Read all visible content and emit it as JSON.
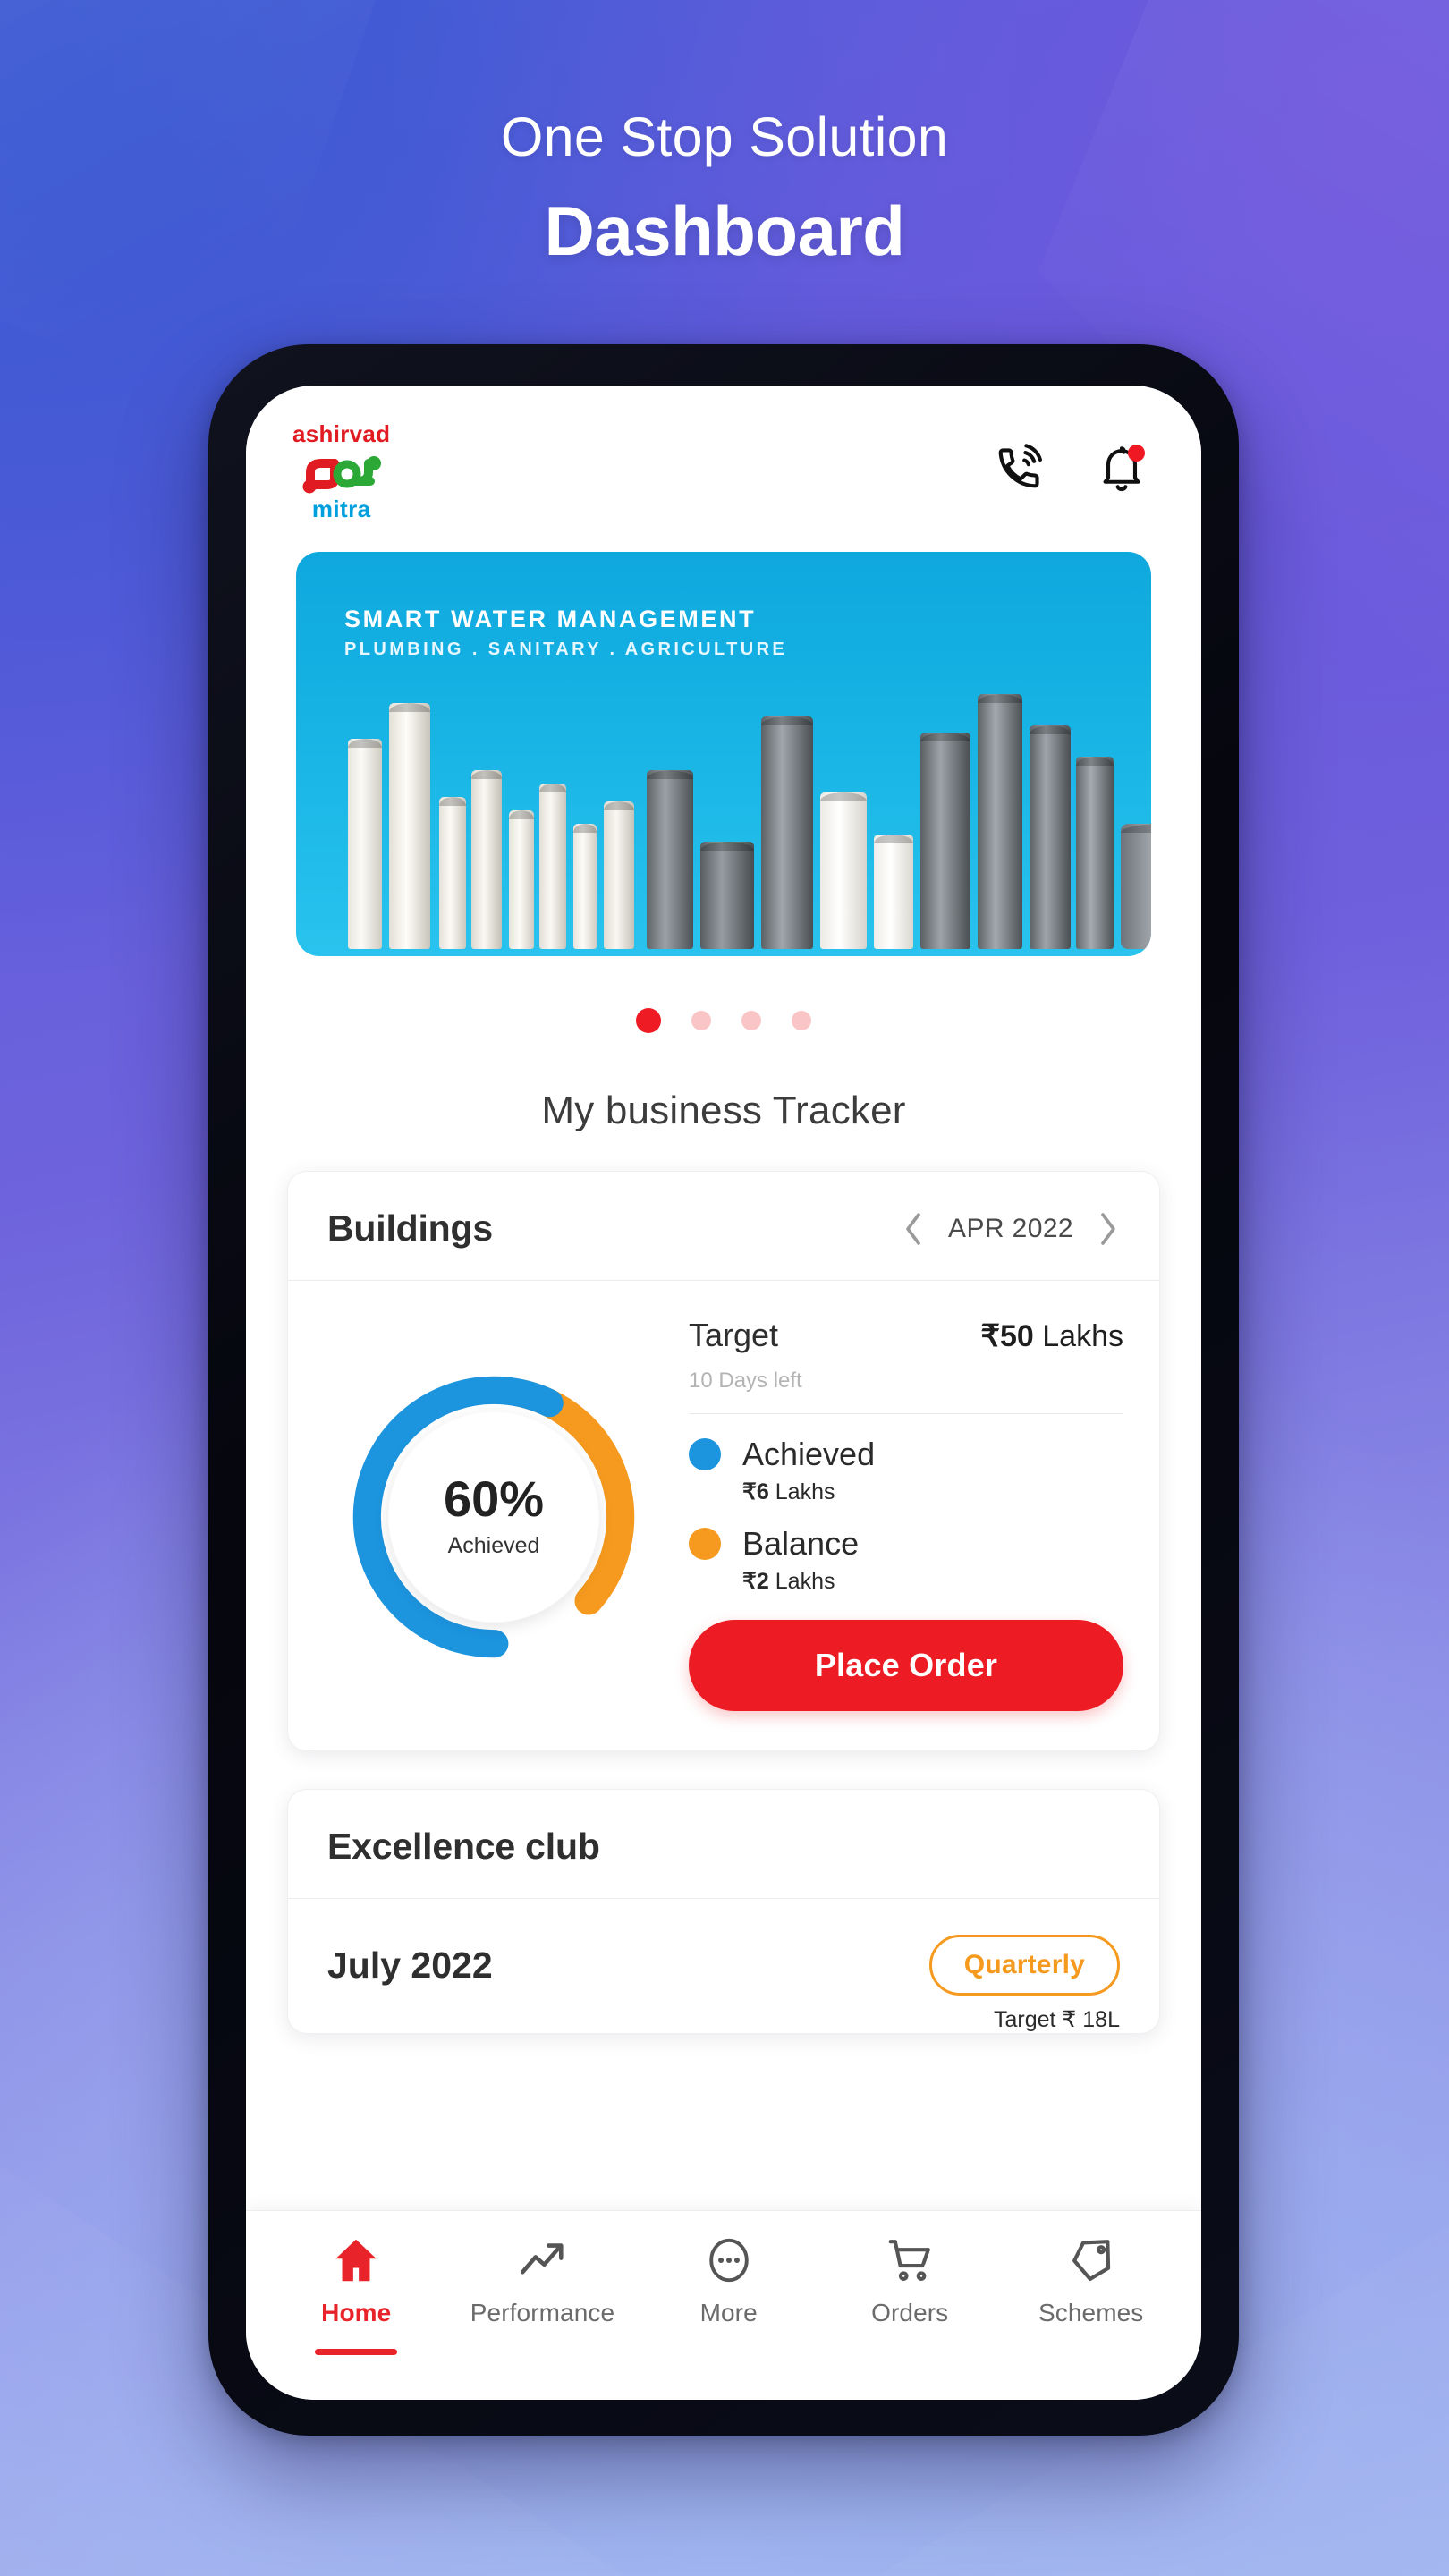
{
  "headline": {
    "eyebrow": "One Stop Solution",
    "title": "Dashboard"
  },
  "colors": {
    "brand_red": "#ED1C24",
    "brand_cyan": "#00A0DF",
    "brand_green": "#2BA836",
    "accent_orange": "#F59A1E",
    "accent_blue": "#1C94DE",
    "bg_gradient_from": "#3A58D2",
    "bg_gradient_to": "#9FB2F0"
  },
  "app": {
    "header": {
      "brand_top": "ashirvad",
      "brand_bottom": "mitra",
      "logo_mark": "ashirvad-mitra-logo",
      "call_icon": "phone-call-icon",
      "notification_icon": "bell-icon",
      "notification_badge": true
    },
    "banner": {
      "title": "SMART WATER MANAGEMENT",
      "subtitle": "PLUMBING . SANITARY . AGRICULTURE",
      "image_alt": "pipes-and-fittings-product-range"
    },
    "carousel": {
      "total": 4,
      "active_index": 0
    },
    "section_title": "My business Tracker",
    "tracker_card": {
      "title": "Buildings",
      "period": "APR 2022",
      "prev_icon": "chevron-left-icon",
      "next_icon": "chevron-right-icon",
      "target_label": "Target",
      "target_currency": "₹",
      "target_amount": "50",
      "target_unit": "Lakhs",
      "days_left": "10 Days left",
      "donut": {
        "percent_label": "60%",
        "percent_sub": "Achieved"
      },
      "legend": [
        {
          "name": "Achieved",
          "currency": "₹",
          "amount": "6",
          "unit": "Lakhs",
          "color": "#1C94DE"
        },
        {
          "name": "Balance",
          "currency": "₹",
          "amount": "2",
          "unit": "Lakhs",
          "color": "#F59A1E"
        }
      ],
      "place_order_label": "Place Order"
    },
    "excellence_card": {
      "title": "Excellence club",
      "month": "July 2022",
      "badge": "Quarterly",
      "target_text": "Target ₹ 18L"
    },
    "bottom_nav": [
      {
        "label": "Home",
        "icon": "home-icon",
        "active": true
      },
      {
        "label": "Performance",
        "icon": "trending-up-icon",
        "active": false
      },
      {
        "label": "More",
        "icon": "more-dots-icon",
        "active": false
      },
      {
        "label": "Orders",
        "icon": "shopping-cart-icon",
        "active": false
      },
      {
        "label": "Schemes",
        "icon": "tag-icon",
        "active": false
      }
    ]
  },
  "chart_data": {
    "type": "pie",
    "title": "Buildings target progress",
    "labels": [
      "Achieved",
      "Balance"
    ],
    "values": [
      60,
      40
    ],
    "value_labels": [
      "₹6 Lakhs",
      "₹2 Lakhs"
    ],
    "colors": [
      "#1C94DE",
      "#F59A1E"
    ],
    "center_label": "60%",
    "center_sublabel": "Achieved",
    "target": 50,
    "target_unit": "Lakhs",
    "legend_position": "right"
  }
}
